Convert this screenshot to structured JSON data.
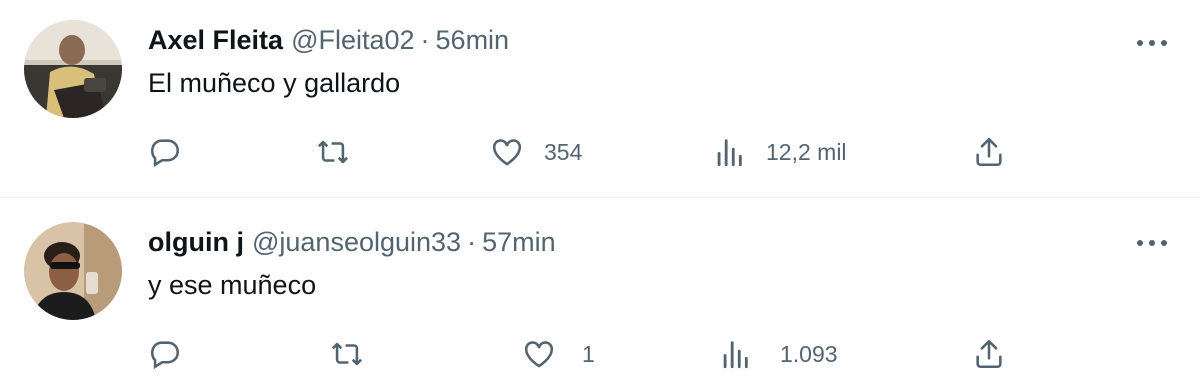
{
  "tweets": [
    {
      "name": "Axel Fleita",
      "handle": "@Fleita02",
      "separator": "·",
      "time": "56min",
      "text": "El muñeco y gallardo",
      "likes": "354",
      "views": "12,2 mil",
      "avatar_icon": "avatar-photo"
    },
    {
      "name": "olguin j",
      "handle": "@juanseolguin33",
      "separator": "·",
      "time": "57min",
      "text": "y ese muñeco",
      "likes": "1",
      "views": "1.093",
      "avatar_icon": "avatar-photo"
    }
  ],
  "icons": {
    "more": "more-icon",
    "reply": "reply-icon",
    "retweet": "retweet-icon",
    "like": "heart-icon",
    "views": "views-icon",
    "share": "share-icon"
  },
  "colors": {
    "text": "#0f1419",
    "secondary": "#536471",
    "divider": "#eff3f4"
  }
}
